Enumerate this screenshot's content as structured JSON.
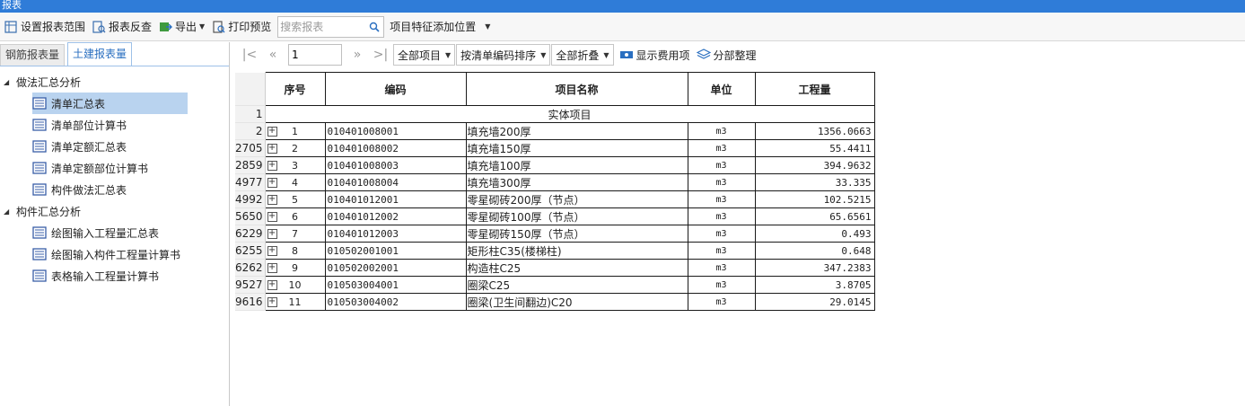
{
  "window": {
    "title": "报表"
  },
  "toolbar": {
    "set_range": "设置报表范围",
    "report_check": "报表反查",
    "export": "导出",
    "print_preview": "打印预览",
    "search_placeholder": "搜索报表",
    "feature_position": "项目特征添加位置"
  },
  "left": {
    "tabs": [
      {
        "label": "钢筋报表量"
      },
      {
        "label": "土建报表量"
      }
    ],
    "groups": [
      {
        "label": "做法汇总分析",
        "items": [
          {
            "label": "清单汇总表"
          },
          {
            "label": "清单部位计算书"
          },
          {
            "label": "清单定额汇总表"
          },
          {
            "label": "清单定额部位计算书"
          },
          {
            "label": "构件做法汇总表"
          }
        ]
      },
      {
        "label": "构件汇总分析",
        "items": [
          {
            "label": "绘图输入工程量汇总表"
          },
          {
            "label": "绘图输入构件工程量计算书"
          },
          {
            "label": "表格输入工程量计算书"
          }
        ]
      }
    ]
  },
  "nav": {
    "page": "1",
    "filter": "全部项目",
    "sort": "按清单编码排序",
    "fold": "全部折叠",
    "show_cost": "显示费用项",
    "section_sort": "分部整理"
  },
  "table": {
    "headers": {
      "seq": "序号",
      "code": "编码",
      "name": "项目名称",
      "unit": "单位",
      "qty": "工程量"
    },
    "section_row": {
      "rownum": "1",
      "label": "实体项目"
    },
    "rows": [
      {
        "rownum": "2",
        "seq": "1",
        "code": "010401008001",
        "name": "填充墙200厚",
        "unit": "m3",
        "qty": "1356.0663"
      },
      {
        "rownum": "2705",
        "seq": "2",
        "code": "010401008002",
        "name": "填充墙150厚",
        "unit": "m3",
        "qty": "55.4411"
      },
      {
        "rownum": "2859",
        "seq": "3",
        "code": "010401008003",
        "name": "填充墙100厚",
        "unit": "m3",
        "qty": "394.9632"
      },
      {
        "rownum": "4977",
        "seq": "4",
        "code": "010401008004",
        "name": "填充墙300厚",
        "unit": "m3",
        "qty": "33.335"
      },
      {
        "rownum": "4992",
        "seq": "5",
        "code": "010401012001",
        "name": "零星砌砖200厚（节点）",
        "unit": "m3",
        "qty": "102.5215"
      },
      {
        "rownum": "5650",
        "seq": "6",
        "code": "010401012002",
        "name": "零星砌砖100厚（节点）",
        "unit": "m3",
        "qty": "65.6561"
      },
      {
        "rownum": "6229",
        "seq": "7",
        "code": "010401012003",
        "name": "零星砌砖150厚（节点）",
        "unit": "m3",
        "qty": "0.493"
      },
      {
        "rownum": "6255",
        "seq": "8",
        "code": "010502001001",
        "name": "矩形柱C35(楼梯柱)",
        "unit": "m3",
        "qty": "0.648"
      },
      {
        "rownum": "6262",
        "seq": "9",
        "code": "010502002001",
        "name": "构造柱C25",
        "unit": "m3",
        "qty": "347.2383"
      },
      {
        "rownum": "9527",
        "seq": "10",
        "code": "010503004001",
        "name": "圈梁C25",
        "unit": "m3",
        "qty": "3.8705"
      },
      {
        "rownum": "9616",
        "seq": "11",
        "code": "010503004002",
        "name": "圈梁(卫生间翻边)C20",
        "unit": "m3",
        "qty": "29.0145"
      }
    ]
  }
}
